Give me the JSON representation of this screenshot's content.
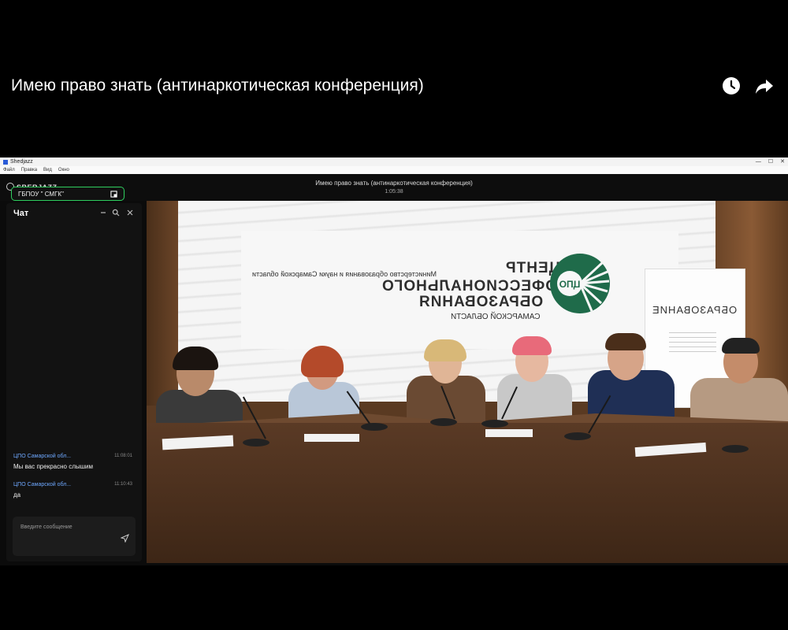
{
  "player": {
    "title": "Имею право знать (антинаркотическая конференция)",
    "clock_icon": "clock-icon",
    "share_icon": "share-icon"
  },
  "window": {
    "app_name": "Shedjazz",
    "menu": [
      "Файл",
      "Правка",
      "Вид",
      "Окно"
    ],
    "controls": [
      "—",
      "☐",
      "✕"
    ]
  },
  "conference": {
    "title": "Имею право знать (антинаркотическая конференция)",
    "elapsed": "1:05:38",
    "brand": "SBERJAZZ",
    "participant_label": "ГБПОУ \" СМГК\""
  },
  "chat": {
    "heading": "Чат",
    "messages": [
      {
        "author": "ЦПО Самарской обл...",
        "time": "11:08:01",
        "text": "Мы вас прекрасно слышим"
      },
      {
        "author": "ЦПО Самарской обл...",
        "time": "11:10:43",
        "text": "да"
      }
    ],
    "input_placeholder": "Введите сообщение"
  },
  "video": {
    "ministry_text": "Министерство образования и науки Самарской области",
    "center_line1": "ЦЕНТР",
    "center_line2": "ПРОФЕССИОНАЛЬНОГО",
    "center_line3": "ОБРАЗОВАНИЯ",
    "center_line4": "САМАРСКОЙ ОБЛАСТИ",
    "emblem_text": "ЦПО",
    "rollup_title": "ОБРАЗОВАНИЕ"
  },
  "colors": {
    "accent_green": "#2fcf5f",
    "chat_author": "#6ea8ff",
    "emblem_green": "#1f6b4a"
  }
}
